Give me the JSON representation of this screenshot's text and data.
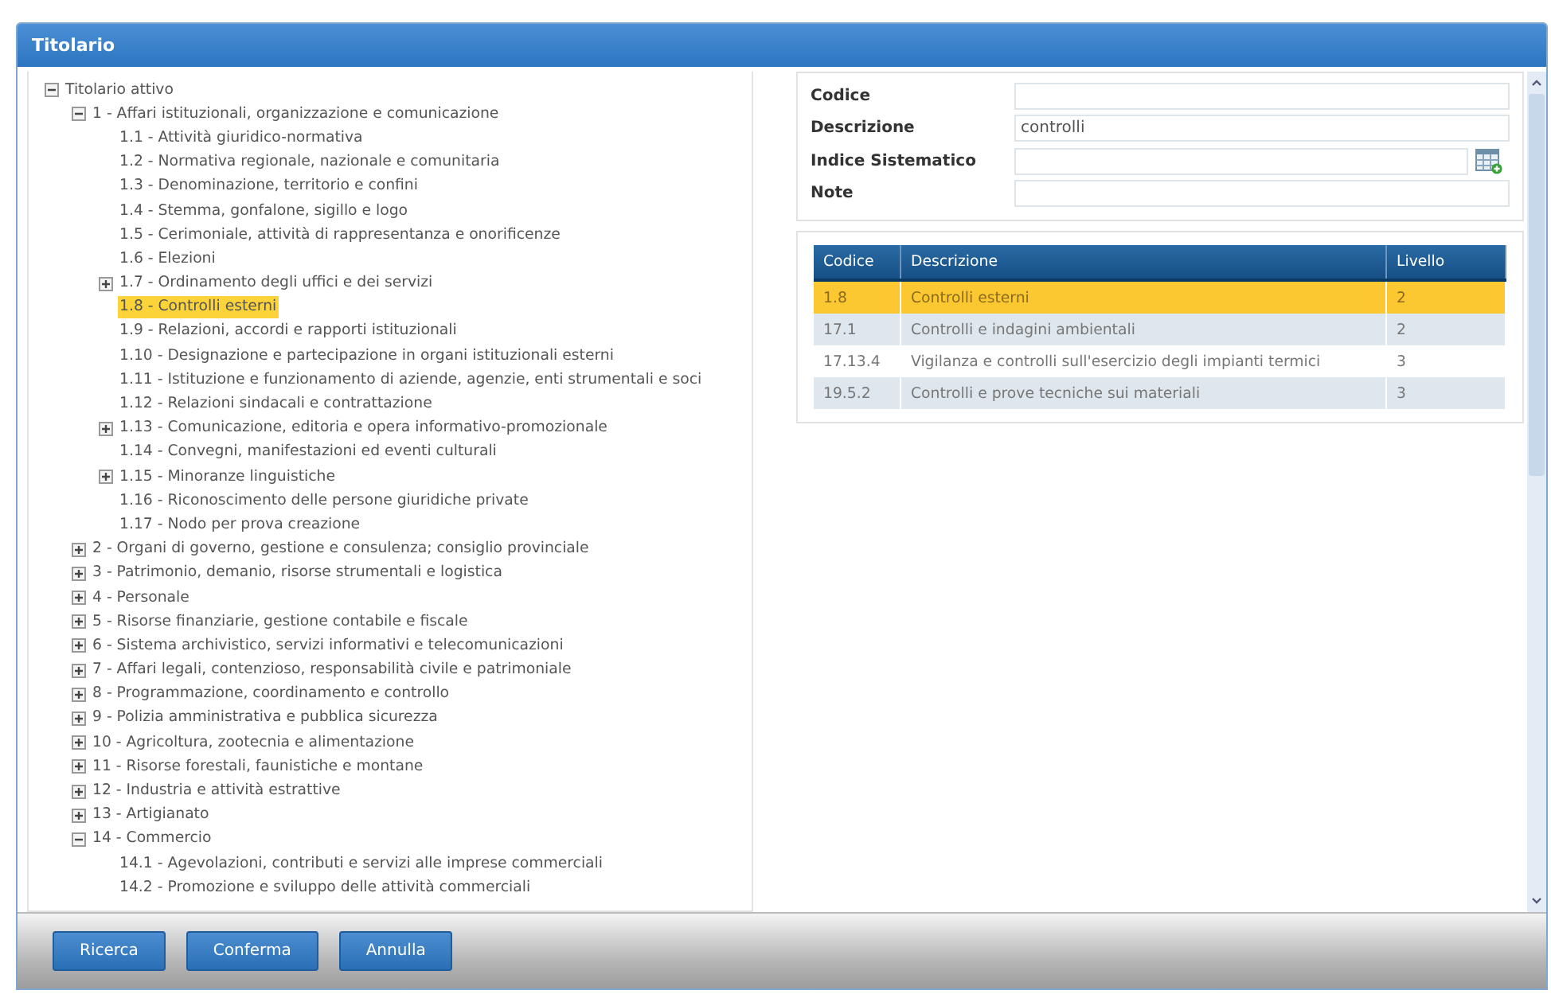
{
  "window": {
    "title": "Titolario"
  },
  "tree": [
    {
      "label": "Titolario attivo",
      "kind": "branch",
      "expanded": true,
      "selected": false,
      "children": [
        {
          "label": "1 - Affari istituzionali, organizzazione e comunicazione",
          "kind": "branch",
          "expanded": true,
          "selected": false,
          "children": [
            {
              "label": "1.1 - Attività giuridico-normativa",
              "kind": "leaf",
              "selected": false
            },
            {
              "label": "1.2 - Normativa regionale, nazionale e comunitaria",
              "kind": "leaf",
              "selected": false
            },
            {
              "label": "1.3 - Denominazione, territorio e confini",
              "kind": "leaf",
              "selected": false
            },
            {
              "label": "1.4 - Stemma, gonfalone, sigillo e logo",
              "kind": "leaf",
              "selected": false
            },
            {
              "label": "1.5 - Cerimoniale, attività di rappresentanza e onorificenze",
              "kind": "leaf",
              "selected": false
            },
            {
              "label": "1.6 - Elezioni",
              "kind": "leaf",
              "selected": false
            },
            {
              "label": "1.7 - Ordinamento degli uffici e dei servizi",
              "kind": "branch",
              "expanded": false,
              "selected": false
            },
            {
              "label": "1.8 - Controlli esterni",
              "kind": "leaf",
              "selected": true
            },
            {
              "label": "1.9 - Relazioni, accordi e rapporti istituzionali",
              "kind": "leaf",
              "selected": false
            },
            {
              "label": "1.10 - Designazione e partecipazione in organi istituzionali esterni",
              "kind": "leaf",
              "selected": false
            },
            {
              "label": "1.11 - Istituzione e funzionamento di aziende, agenzie, enti strumentali e soci",
              "kind": "leaf",
              "selected": false
            },
            {
              "label": "1.12 - Relazioni sindacali e contrattazione",
              "kind": "leaf",
              "selected": false
            },
            {
              "label": "1.13 - Comunicazione, editoria e opera informativo-promozionale",
              "kind": "branch",
              "expanded": false,
              "selected": false
            },
            {
              "label": "1.14 - Convegni, manifestazioni ed eventi culturali",
              "kind": "leaf",
              "selected": false
            },
            {
              "label": "1.15 - Minoranze linguistiche",
              "kind": "branch",
              "expanded": false,
              "selected": false
            },
            {
              "label": "1.16 - Riconoscimento delle persone giuridiche private",
              "kind": "leaf",
              "selected": false
            },
            {
              "label": "1.17 - Nodo per prova creazione",
              "kind": "leaf",
              "selected": false
            }
          ]
        },
        {
          "label": "2 - Organi di governo, gestione e consulenza; consiglio provinciale",
          "kind": "branch",
          "expanded": false,
          "selected": false
        },
        {
          "label": "3 - Patrimonio, demanio, risorse strumentali e logistica",
          "kind": "branch",
          "expanded": false,
          "selected": false
        },
        {
          "label": "4 - Personale",
          "kind": "branch",
          "expanded": false,
          "selected": false
        },
        {
          "label": "5 - Risorse finanziarie, gestione contabile e fiscale",
          "kind": "branch",
          "expanded": false,
          "selected": false
        },
        {
          "label": "6 - Sistema archivistico, servizi informativi e telecomunicazioni",
          "kind": "branch",
          "expanded": false,
          "selected": false
        },
        {
          "label": "7 - Affari legali, contenzioso, responsabilità civile e patrimoniale",
          "kind": "branch",
          "expanded": false,
          "selected": false
        },
        {
          "label": "8 - Programmazione, coordinamento e controllo",
          "kind": "branch",
          "expanded": false,
          "selected": false
        },
        {
          "label": "9 - Polizia amministrativa e pubblica sicurezza",
          "kind": "branch",
          "expanded": false,
          "selected": false
        },
        {
          "label": "10 - Agricoltura, zootecnia e alimentazione",
          "kind": "branch",
          "expanded": false,
          "selected": false
        },
        {
          "label": "11 - Risorse forestali, faunistiche e montane",
          "kind": "branch",
          "expanded": false,
          "selected": false
        },
        {
          "label": "12 - Industria e attività estrattive",
          "kind": "branch",
          "expanded": false,
          "selected": false
        },
        {
          "label": "13 - Artigianato",
          "kind": "branch",
          "expanded": false,
          "selected": false
        },
        {
          "label": "14 - Commercio",
          "kind": "branch",
          "expanded": true,
          "selected": false,
          "children": [
            {
              "label": "14.1 - Agevolazioni, contributi e servizi alle imprese commerciali",
              "kind": "leaf",
              "selected": false
            },
            {
              "label": "14.2 - Promozione e sviluppo delle attività commerciali",
              "kind": "leaf",
              "selected": false
            }
          ]
        }
      ]
    }
  ],
  "form": {
    "fields": [
      {
        "label": "Codice",
        "kind": "text"
      },
      {
        "label": "Descrizione",
        "value": "controlli",
        "kind": "text"
      },
      {
        "label": "Indice Sistematico",
        "kind": "picker"
      },
      {
        "label": "Note",
        "kind": "text"
      }
    ]
  },
  "results": {
    "columns": [
      "Codice",
      "Descrizione",
      "Livello"
    ],
    "rows": [
      {
        "cells": [
          "1.8",
          "Controlli esterni",
          "2"
        ],
        "selected": true
      },
      {
        "cells": [
          "17.1",
          "Controlli e indagini ambientali",
          "2"
        ],
        "selected": false
      },
      {
        "cells": [
          "17.13.4",
          "Vigilanza e controlli sull'esercizio degli impianti termici",
          "3"
        ],
        "selected": false
      },
      {
        "cells": [
          "19.5.2",
          "Controlli e prove tecniche sui materiali",
          "3"
        ],
        "selected": false
      }
    ]
  },
  "buttons": [
    "Ricerca",
    "Conferma",
    "Annulla"
  ]
}
